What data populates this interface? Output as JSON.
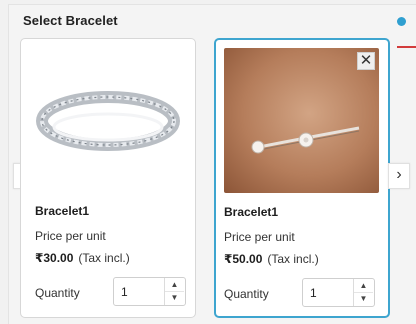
{
  "header": {
    "title": "Select Bracelet"
  },
  "products": [
    {
      "name": "Bracelet1",
      "price_label": "Price per unit",
      "price": "₹30.00",
      "tax_note": "(Tax incl.)",
      "quantity_label": "Quantity",
      "quantity": "1",
      "selected": false,
      "image_icon": "silver-chain-bracelet"
    },
    {
      "name": "Bracelet1",
      "price_label": "Price per unit",
      "price": "₹50.00",
      "tax_note": "(Tax incl.)",
      "quantity_label": "Quantity",
      "quantity": "1",
      "selected": true,
      "image_icon": "cuff-bracelet"
    }
  ],
  "controls": {
    "close_glyph": "✕",
    "prev_glyph": "‹",
    "next_glyph": "›",
    "step_up_glyph": "▲",
    "step_down_glyph": "▼"
  },
  "colors": {
    "selected_border": "#3ea5cf",
    "info_dot": "#2f9fd0",
    "pointer_line": "#d23b3b"
  }
}
